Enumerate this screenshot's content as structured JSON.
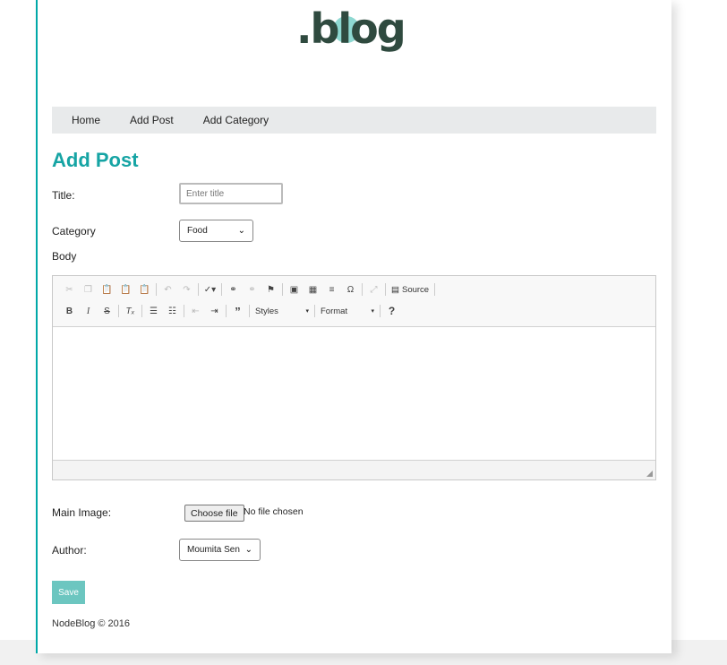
{
  "brand": {
    "logo_text": ".blog",
    "color": "#2f4a3f",
    "bubble": "#8ed8d1"
  },
  "nav": {
    "items": [
      {
        "label": "Home"
      },
      {
        "label": "Add Post"
      },
      {
        "label": "Add Category"
      }
    ]
  },
  "page": {
    "title": "Add Post"
  },
  "form": {
    "title_label": "Title:",
    "title_placeholder": "Enter title",
    "title_value": "",
    "category_label": "Category",
    "category_value": "Food",
    "body_label": "Body",
    "main_image_label": "Main Image:",
    "file_button_label": "Choose file",
    "file_status": "No file chosen",
    "author_label": "Author:",
    "author_value": "Moumita Sen",
    "save_label": "Save"
  },
  "editor": {
    "source_label": "Source",
    "styles_label": "Styles",
    "format_label": "Format",
    "help_label": "?"
  },
  "footer": {
    "text": "NodeBlog © 2016"
  },
  "colors": {
    "accent": "#16a4a4",
    "save": "#6cc6c0",
    "nav_bg": "#e8eaeb"
  }
}
